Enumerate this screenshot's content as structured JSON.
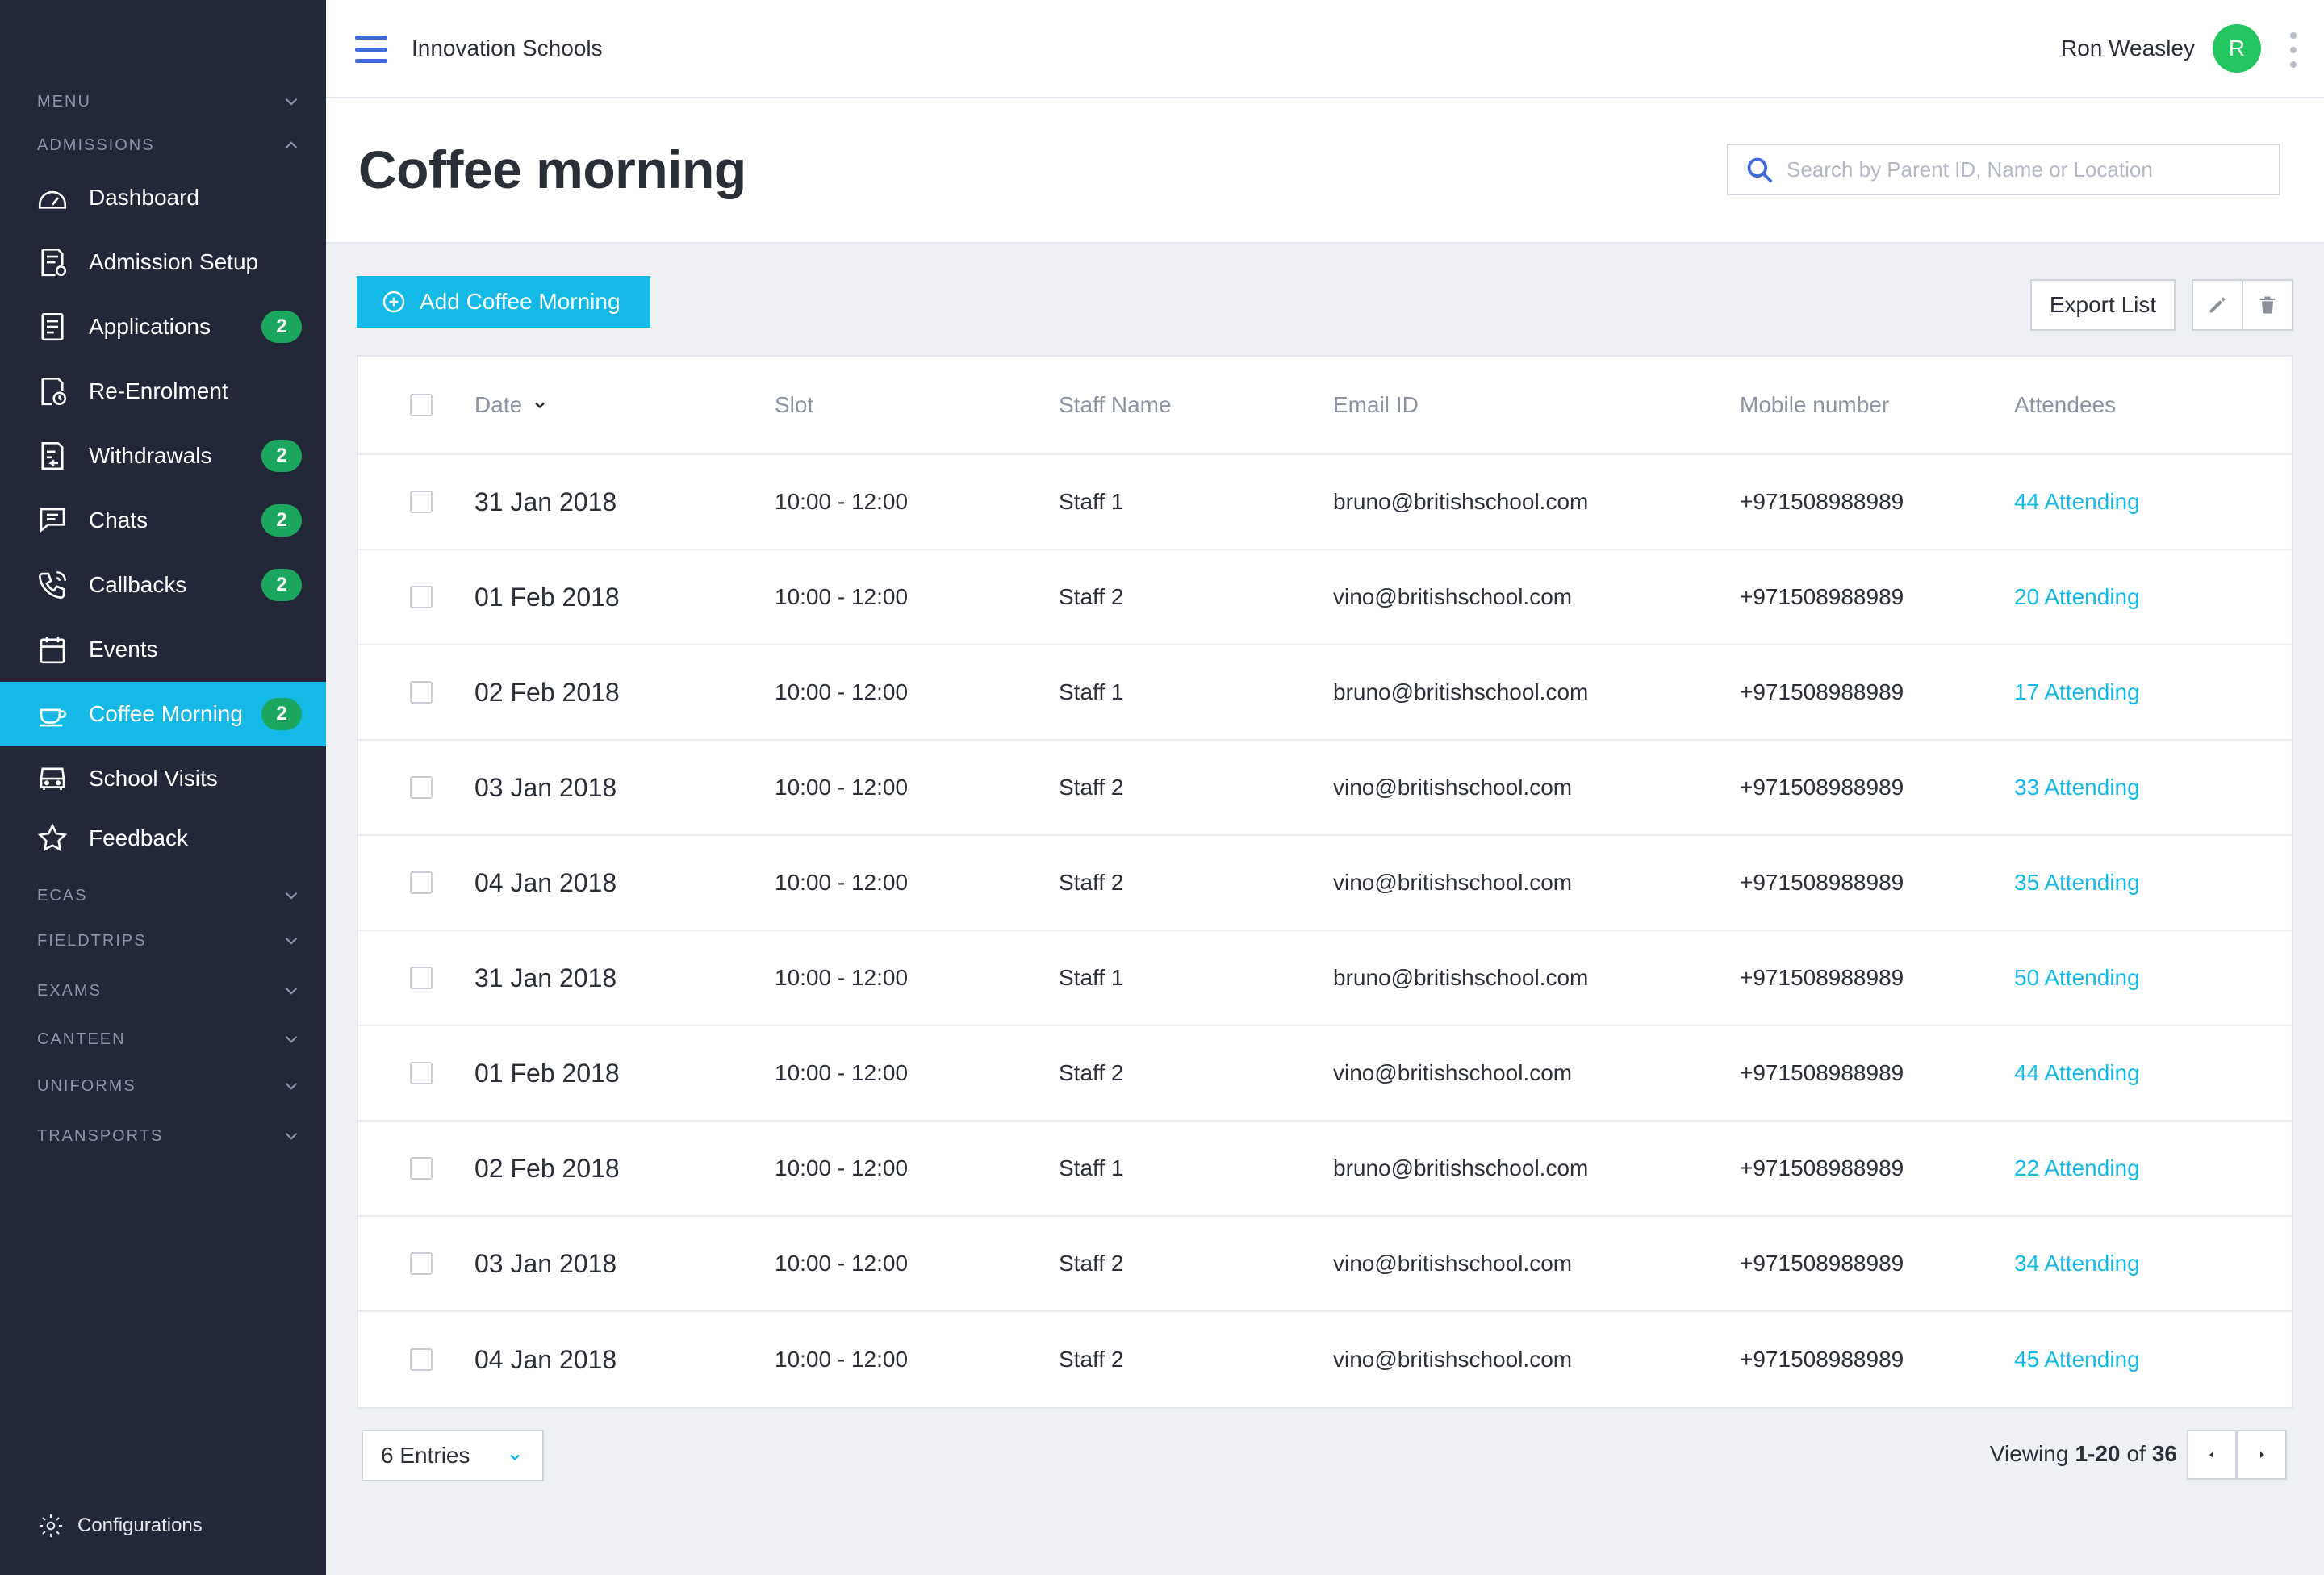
{
  "topbar": {
    "org_name": "Innovation Schools",
    "user_name": "Ron Weasley",
    "user_initial": "R"
  },
  "sidebar": {
    "menu_label": "MENU",
    "admissions_label": "ADMISSIONS",
    "items": [
      {
        "label": "Dashboard",
        "icon": "dashboard-icon"
      },
      {
        "label": "Admission Setup",
        "icon": "admission-setup-icon"
      },
      {
        "label": "Applications",
        "icon": "applications-icon",
        "badge": "2"
      },
      {
        "label": "Re-Enrolment",
        "icon": "re-enrolment-icon"
      },
      {
        "label": "Withdrawals",
        "icon": "withdrawals-icon",
        "badge": "2"
      },
      {
        "label": "Chats",
        "icon": "chat-icon",
        "badge": "2"
      },
      {
        "label": "Callbacks",
        "icon": "phone-icon",
        "badge": "2"
      },
      {
        "label": "Events",
        "icon": "calendar-icon"
      },
      {
        "label": "Coffee Morning",
        "icon": "coffee-cup-icon",
        "badge": "2",
        "active": true
      },
      {
        "label": "School Visits",
        "icon": "bus-icon"
      },
      {
        "label": "Feedback",
        "icon": "star-icon"
      }
    ],
    "sections": [
      "ECAS",
      "FIELDTRIPS",
      "EXAMS",
      "CANTEEN",
      "UNIFORMS",
      "TRANSPORTS"
    ],
    "configurations_label": "Configurations"
  },
  "page": {
    "title": "Coffee morning",
    "search_placeholder": "Search by Parent ID, Name or Location",
    "add_button": "Add Coffee Morning",
    "export_button": "Export List"
  },
  "table": {
    "columns": {
      "date": "Date",
      "slot": "Slot",
      "staff": "Staff Name",
      "email": "Email ID",
      "mobile": "Mobile number",
      "attendees": "Attendees"
    },
    "rows": [
      {
        "date": "31 Jan 2018",
        "slot": "10:00 - 12:00",
        "staff": "Staff 1",
        "email": "bruno@britishschool.com",
        "mobile": "+971508988989",
        "attendees": "44 Attending"
      },
      {
        "date": "01 Feb 2018",
        "slot": "10:00 - 12:00",
        "staff": "Staff 2",
        "email": "vino@britishschool.com",
        "mobile": "+971508988989",
        "attendees": "20 Attending"
      },
      {
        "date": "02 Feb 2018",
        "slot": "10:00 - 12:00",
        "staff": "Staff 1",
        "email": "bruno@britishschool.com",
        "mobile": "+971508988989",
        "attendees": "17 Attending"
      },
      {
        "date": "03 Jan 2018",
        "slot": "10:00 - 12:00",
        "staff": "Staff 2",
        "email": "vino@britishschool.com",
        "mobile": "+971508988989",
        "attendees": "33 Attending"
      },
      {
        "date": "04 Jan 2018",
        "slot": "10:00 - 12:00",
        "staff": "Staff 2",
        "email": "vino@britishschool.com",
        "mobile": "+971508988989",
        "attendees": "35 Attending"
      },
      {
        "date": "31 Jan 2018",
        "slot": "10:00 - 12:00",
        "staff": "Staff 1",
        "email": "bruno@britishschool.com",
        "mobile": "+971508988989",
        "attendees": "50 Attending"
      },
      {
        "date": "01 Feb 2018",
        "slot": "10:00 - 12:00",
        "staff": "Staff 2",
        "email": "vino@britishschool.com",
        "mobile": "+971508988989",
        "attendees": "44 Attending"
      },
      {
        "date": "02 Feb 2018",
        "slot": "10:00 - 12:00",
        "staff": "Staff 1",
        "email": "bruno@britishschool.com",
        "mobile": "+971508988989",
        "attendees": "22 Attending"
      },
      {
        "date": "03 Jan 2018",
        "slot": "10:00 - 12:00",
        "staff": "Staff 2",
        "email": "vino@britishschool.com",
        "mobile": "+971508988989",
        "attendees": "34 Attending"
      },
      {
        "date": "04 Jan 2018",
        "slot": "10:00 - 12:00",
        "staff": "Staff 2",
        "email": "vino@britishschool.com",
        "mobile": "+971508988989",
        "attendees": "45 Attending"
      }
    ]
  },
  "footer": {
    "entries_select": "6 Entries",
    "viewing_prefix": "Viewing",
    "viewing_range": "1-20",
    "viewing_of": "of",
    "viewing_total": "36"
  },
  "colors": {
    "sidebar_bg": "#232838",
    "accent": "#14b9e6",
    "badge": "#1ba85e",
    "avatar": "#22c55e",
    "hamburger": "#3f6bd6"
  }
}
